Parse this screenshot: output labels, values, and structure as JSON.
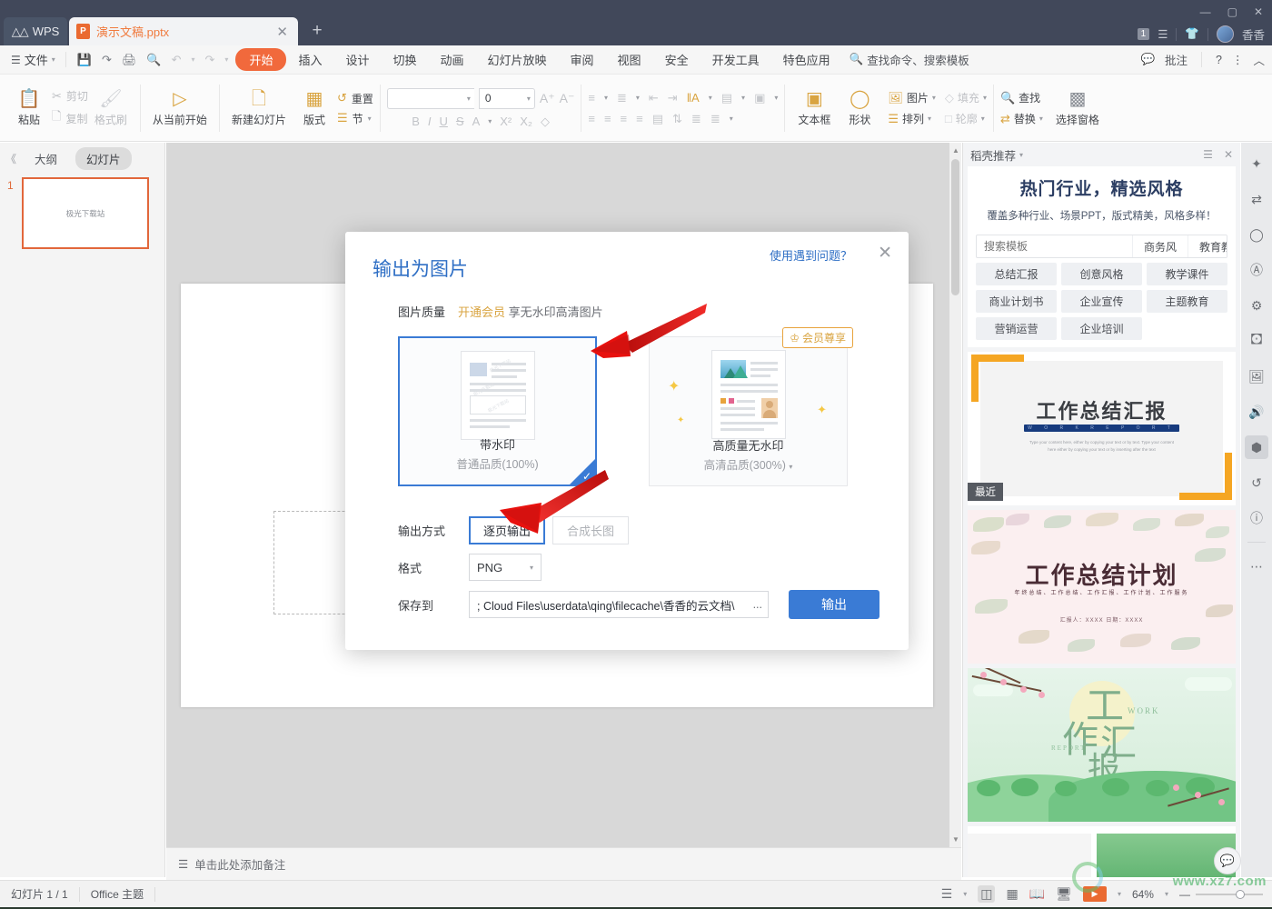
{
  "titlebar": {
    "wps_label": "WPS",
    "doc_tab": "演示文稿.pptx",
    "new_tab": "+",
    "close_tab": "✕",
    "minimize": "—",
    "maximize": "▢",
    "close": "✕",
    "badge_count": "1",
    "user_name": "香香"
  },
  "menubar": {
    "file": "文件",
    "quick_access": [
      "save-icon",
      "save-as-icon",
      "print-icon",
      "print-preview-icon",
      "undo-icon",
      "redo-icon",
      "customize-icon"
    ],
    "tabs": [
      {
        "label": "开始",
        "active": true
      },
      {
        "label": "插入",
        "active": false
      },
      {
        "label": "设计",
        "active": false
      },
      {
        "label": "切换",
        "active": false
      },
      {
        "label": "动画",
        "active": false
      },
      {
        "label": "幻灯片放映",
        "active": false
      },
      {
        "label": "审阅",
        "active": false
      },
      {
        "label": "视图",
        "active": false
      },
      {
        "label": "安全",
        "active": false
      },
      {
        "label": "开发工具",
        "active": false
      },
      {
        "label": "特色应用",
        "active": false
      }
    ],
    "search_placeholder": "查找命令、搜索模板",
    "comment": "批注",
    "help": "?",
    "more": "⋮",
    "collapse": "︿"
  },
  "ribbon": {
    "paste": "粘贴",
    "cut": "剪切",
    "copy": "复制",
    "format_painter": "格式刷",
    "start_from_current": "从当前开始",
    "new_slide": "新建幻灯片",
    "layout": "版式",
    "reset": "重置",
    "section": "节",
    "font_name": "",
    "font_size": "0",
    "font_grow": "A",
    "font_shrink": "A",
    "bold": "B",
    "italic": "I",
    "underline": "U",
    "strike": "S",
    "font_color": "A",
    "superscript": "X²",
    "subscript": "X₂",
    "clear_format": "◇",
    "textbox": "文本框",
    "shape": "形状",
    "picture": "图片",
    "fill": "填充",
    "arrange": "排列",
    "outline": "轮廓",
    "find": "查找",
    "replace": "替换",
    "select_pane": "选择窗格"
  },
  "left_panel": {
    "collapse": "《",
    "tab_outline": "大纲",
    "tab_slides": "幻灯片",
    "slides": [
      {
        "number": "1",
        "text": "极光下载站"
      }
    ]
  },
  "notes": {
    "placeholder": "单击此处添加备注"
  },
  "docer": {
    "header": "稻壳推荐",
    "list_icon": "list-icon",
    "close_icon": "✕",
    "title": "热门行业，精选风格",
    "subtitle": "覆盖多种行业、场景PPT，版式精美，风格多样！",
    "search_placeholder": "搜索模板",
    "quick_tags": [
      "商务风",
      "教育教学"
    ],
    "tags": [
      "总结汇报",
      "创意风格",
      "教学课件",
      "商业计划书",
      "企业宣传",
      "主题教育",
      "营销运营",
      "企业培训"
    ],
    "templates": [
      {
        "badge": "最近",
        "title": "工作总结汇报",
        "bar_text": "W O R K   R E P O R T",
        "desc": "Type your content here, either by copying your text or by text. Type your content here either by copying your text or by inserting after the text"
      },
      {
        "badge": "",
        "title": "工作总结计划",
        "subtitle": "年终总结、工作总结、工作汇报、工作计划、工作服务",
        "footer": "汇报人：XXXX          日期：XXXX"
      },
      {
        "badge": "",
        "title_chars": [
          "工",
          "作",
          "汇",
          "报"
        ],
        "work_label": "WORK",
        "report_label": "REPORT"
      }
    ]
  },
  "rail": {
    "items": [
      {
        "icon": "magic-star-icon",
        "selected": false
      },
      {
        "icon": "transition-icon",
        "selected": false
      },
      {
        "icon": "shapes-icon",
        "selected": false
      },
      {
        "icon": "text-art-icon",
        "selected": false
      },
      {
        "icon": "adjust-sliders-icon",
        "selected": false
      },
      {
        "icon": "image-group-icon",
        "selected": false
      },
      {
        "icon": "image-icon",
        "selected": false
      },
      {
        "icon": "speaker-icon",
        "selected": false
      },
      {
        "icon": "shield-badge-icon",
        "selected": true
      },
      {
        "icon": "history-icon",
        "selected": false
      },
      {
        "icon": "help-circle-icon",
        "selected": false
      },
      {
        "icon": "more-dots-icon",
        "selected": false
      }
    ]
  },
  "statusbar": {
    "slide_count": "幻灯片 1 / 1",
    "theme": "Office 主题",
    "view_icons": [
      "outline-view-icon",
      "normal-view-icon",
      "slide-sorter-icon",
      "reading-view-icon",
      "presenter-view-icon"
    ],
    "play_label": "▶",
    "zoom_level": "64%",
    "zoom_minus": "—",
    "watermark": "www.xz7.com"
  },
  "dialog": {
    "title": "输出为图片",
    "help_link": "使用遇到问题？",
    "close": "✕",
    "quality_label": "图片质量",
    "quality_promo_gold": "开通会员",
    "quality_promo_grey": "享无水印高清图片",
    "cards": [
      {
        "name": "带水印",
        "quality": "普通品质(100%)",
        "selected": true,
        "vip": false,
        "watermark_text": "极光下载站"
      },
      {
        "name": "高质量无水印",
        "quality": "高清品质(300%)",
        "selected": false,
        "vip": true,
        "vip_badge": "会员尊享"
      }
    ],
    "output_mode_label": "输出方式",
    "output_mode_options": [
      {
        "label": "逐页输出",
        "active": true
      },
      {
        "label": "合成长图",
        "active": false
      }
    ],
    "format_label": "格式",
    "format_value": "PNG",
    "save_to_label": "保存到",
    "save_to_value": "; Cloud Files\\userdata\\qing\\filecache\\香香的云文档\\",
    "save_to_ellipsis": "...",
    "export_button": "输出"
  },
  "colors": {
    "accent_blue": "#3a7bd5",
    "accent_orange": "#ea6a31",
    "vip_gold": "#d9a441",
    "titlebar_bg": "#41485a",
    "arrow_red": "#e8110e"
  }
}
